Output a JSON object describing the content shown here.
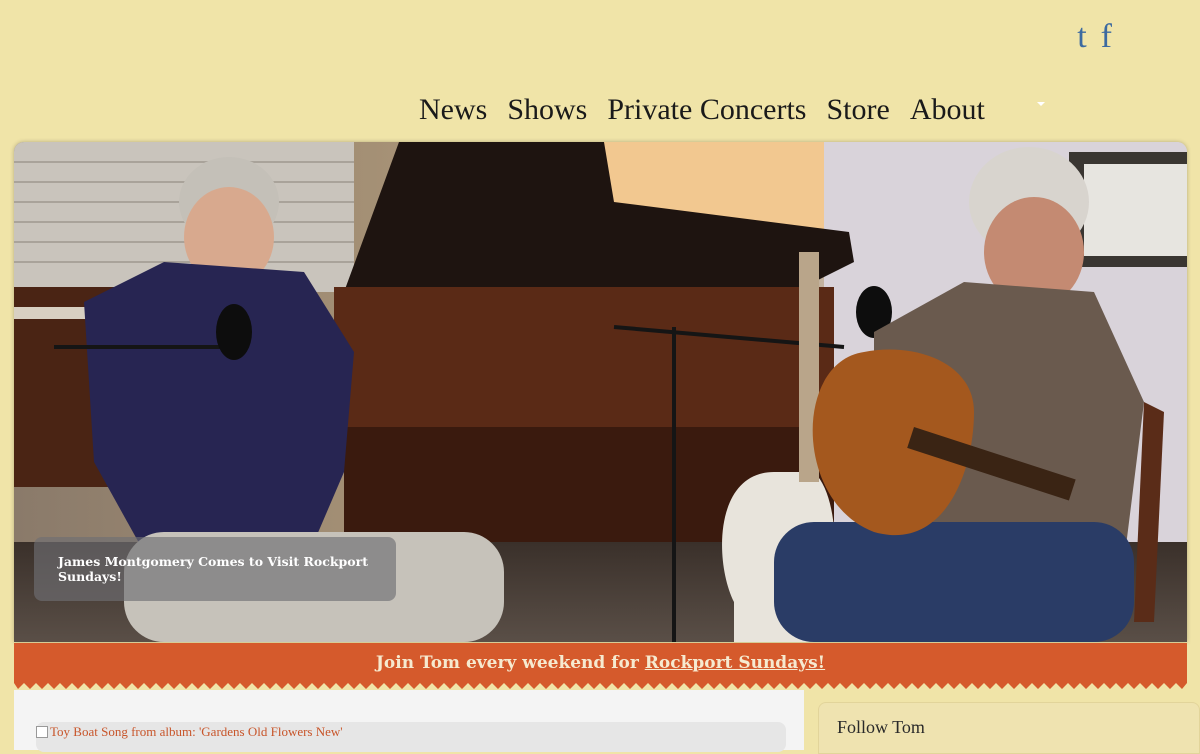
{
  "social": [
    {
      "icon": "tumblr-icon",
      "label": "t"
    },
    {
      "icon": "facebook-icon",
      "label": "f"
    }
  ],
  "nav": {
    "items": [
      "News",
      "Shows",
      "Private Concerts",
      "Store",
      "About"
    ]
  },
  "hero": {
    "caption": "James Montgomery Comes to Visit Rockport Sundays!"
  },
  "banner": {
    "prefix": "Join Tom every weekend for ",
    "link": "Rockport Sundays!"
  },
  "player": {
    "alt_text": "Toy Boat Song from album: 'Gardens Old Flowers New'"
  },
  "sidebar": {
    "follow_title": "Follow Tom"
  },
  "colors": {
    "page_bg": "#f0e4a8",
    "banner": "#d55a2c",
    "social": "#3c6aa0"
  }
}
